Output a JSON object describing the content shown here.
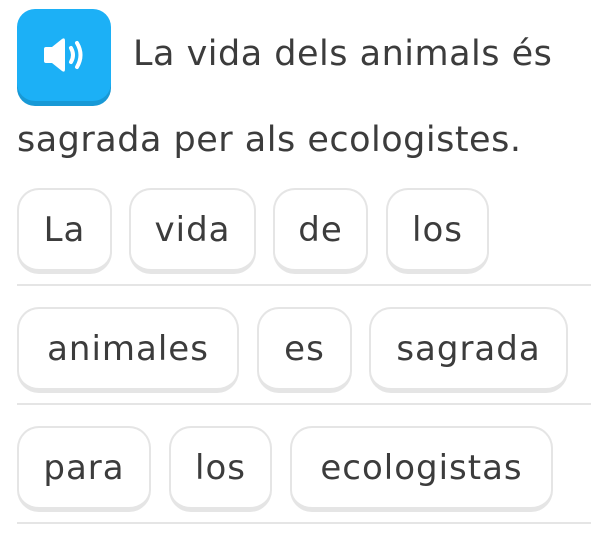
{
  "prompt": {
    "line1": "La vida dels animals és",
    "line2": "sagrada per als ecologistes.",
    "audio_icon": "speaker-icon",
    "accent_color": "#1cb0f6"
  },
  "word_bank": {
    "rows": [
      [
        "La",
        "vida",
        "de",
        "los"
      ],
      [
        "animales",
        "es",
        "sagrada"
      ],
      [
        "para",
        "los",
        "ecologistas"
      ]
    ]
  }
}
